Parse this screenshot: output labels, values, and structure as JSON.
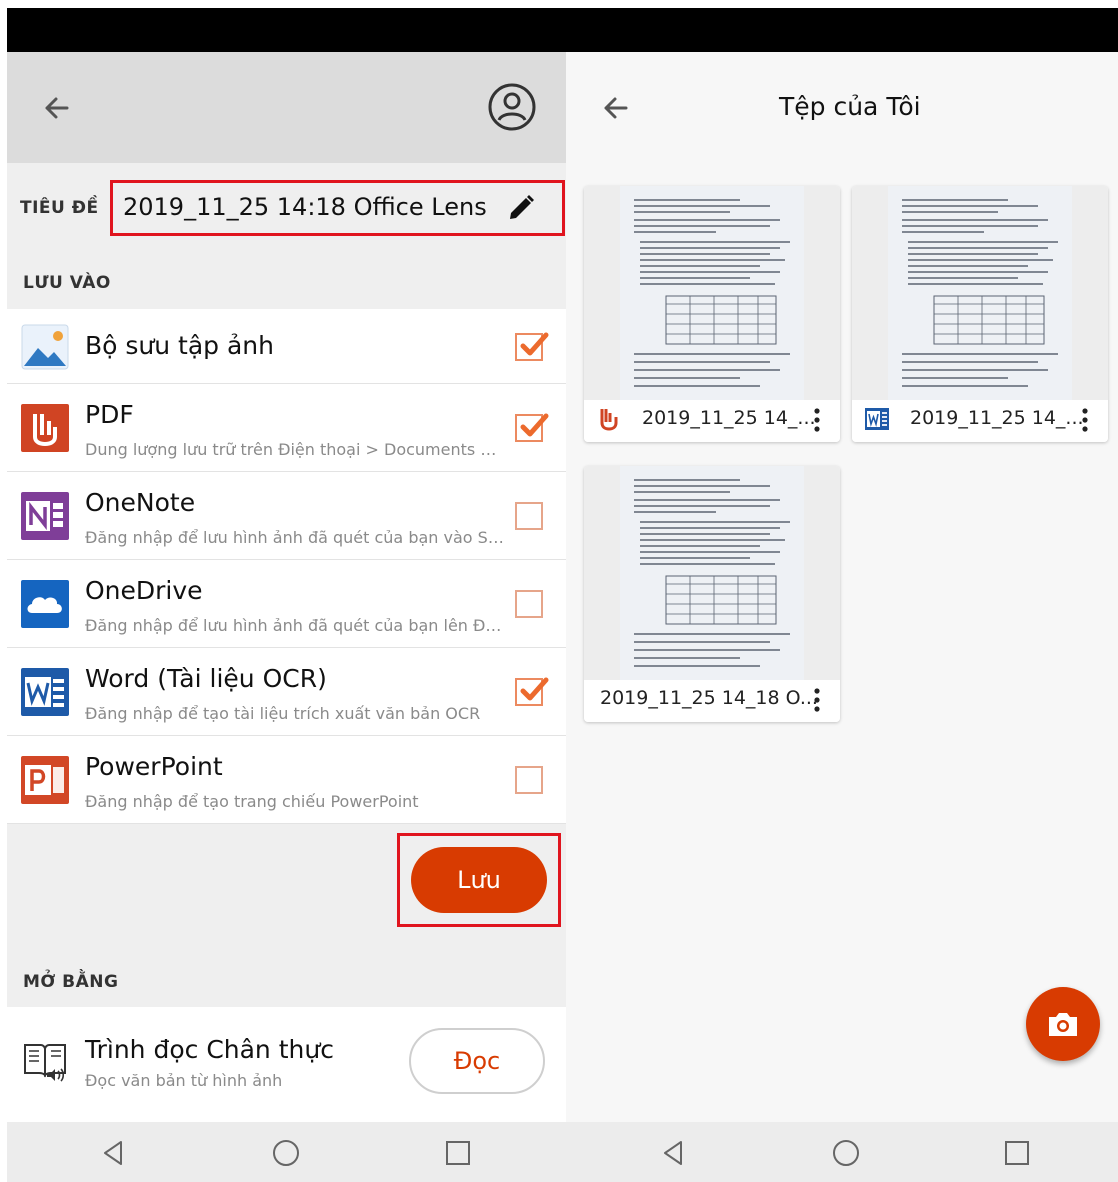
{
  "left_panel": {
    "title_label": "TIÊU ĐỀ",
    "title_value": "2019_11_25 14:18 Office Lens",
    "save_to_label": "LƯU VÀO",
    "destinations": [
      {
        "title": "Bộ sưu tập ảnh",
        "subtitle": "",
        "checked": true
      },
      {
        "title": "PDF",
        "subtitle": "Dung lượng lưu trữ trên Điện thoại > Documents > Offi...",
        "checked": true
      },
      {
        "title": "OneNote",
        "subtitle": "Đăng nhập để lưu hình ảnh đã quét của bạn vào Sổ tay",
        "checked": false
      },
      {
        "title": "OneDrive",
        "subtitle": "Đăng nhập để lưu hình ảnh đã quét của bạn lên Đám...",
        "checked": false
      },
      {
        "title": "Word (Tài liệu OCR)",
        "subtitle": "Đăng nhập để tạo tài liệu trích xuất văn bản OCR",
        "checked": true
      },
      {
        "title": "PowerPoint",
        "subtitle": "Đăng nhập để tạo trang chiếu PowerPoint",
        "checked": false
      }
    ],
    "save_button": "Lưu",
    "open_with_label": "MỞ BẰNG",
    "reader": {
      "title": "Trình đọc Chân thực",
      "subtitle": "Đọc văn bản từ hình ảnh",
      "button": "Đọc"
    }
  },
  "right_panel": {
    "title": "Tệp của Tôi",
    "files": [
      {
        "name": "2019_11_25 14_...",
        "type": "pdf-icon"
      },
      {
        "name": "2019_11_25 14_...",
        "type": "word-icon"
      },
      {
        "name": "2019_11_25 14_18 O...",
        "type": "none"
      }
    ]
  },
  "colors": {
    "accent": "#d83b01",
    "highlight": "#e0141e",
    "checkbox": "#ec8a60"
  }
}
